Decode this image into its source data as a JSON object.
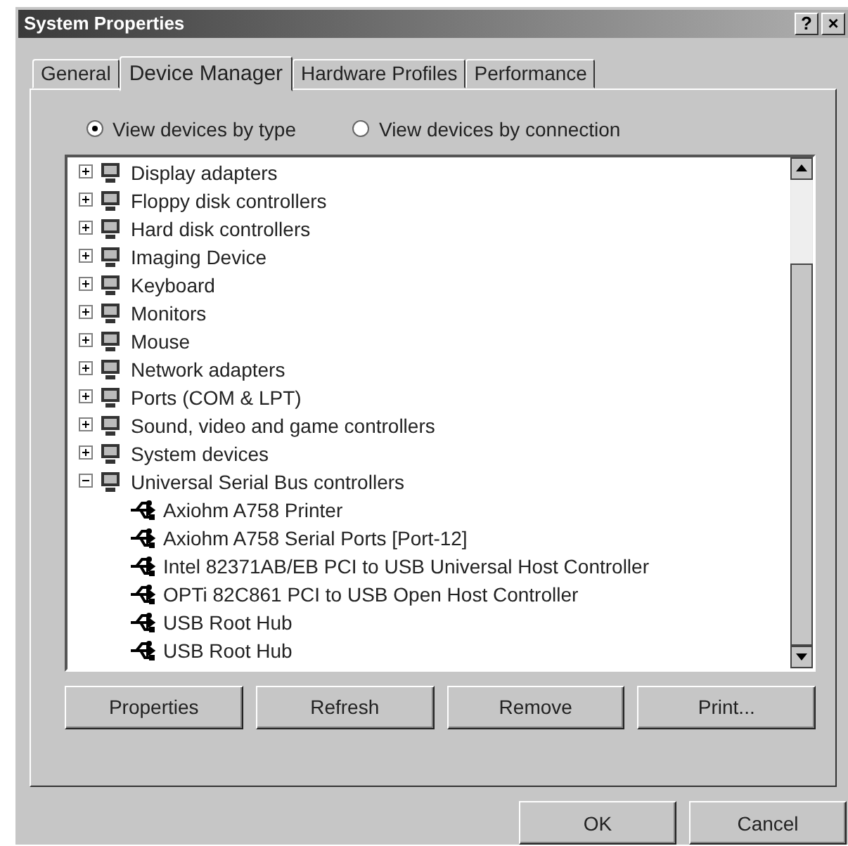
{
  "window": {
    "title": "System Properties",
    "help_button": "?",
    "close_button": "×"
  },
  "tabs": [
    {
      "label": "General",
      "selected": false
    },
    {
      "label": "Device Manager",
      "selected": true
    },
    {
      "label": "Hardware Profiles",
      "selected": false
    },
    {
      "label": "Performance",
      "selected": false
    }
  ],
  "view_options": [
    {
      "label": "View devices by type",
      "selected": true
    },
    {
      "label": "View devices by connection",
      "selected": false
    }
  ],
  "device_tree": [
    {
      "label": "Display adapters",
      "expanded": false
    },
    {
      "label": "Floppy disk controllers",
      "expanded": false
    },
    {
      "label": "Hard disk controllers",
      "expanded": false
    },
    {
      "label": "Imaging Device",
      "expanded": false
    },
    {
      "label": "Keyboard",
      "expanded": false
    },
    {
      "label": "Monitors",
      "expanded": false
    },
    {
      "label": "Mouse",
      "expanded": false
    },
    {
      "label": "Network adapters",
      "expanded": false
    },
    {
      "label": "Ports (COM & LPT)",
      "expanded": false
    },
    {
      "label": "Sound, video and game controllers",
      "expanded": false
    },
    {
      "label": "System devices",
      "expanded": false
    },
    {
      "label": "Universal Serial Bus controllers",
      "expanded": true,
      "children": [
        {
          "label": "Axiohm A758 Printer"
        },
        {
          "label": "Axiohm A758 Serial Ports [Port-12]"
        },
        {
          "label": "Intel 82371AB/EB PCI to USB Universal Host Controller"
        },
        {
          "label": "OPTi 82C861 PCI to USB Open Host Controller"
        },
        {
          "label": "USB Root Hub"
        },
        {
          "label": "USB Root Hub"
        }
      ]
    }
  ],
  "panel_buttons": [
    "Properties",
    "Refresh",
    "Remove",
    "Print..."
  ],
  "dialog_buttons": [
    "OK",
    "Cancel"
  ]
}
